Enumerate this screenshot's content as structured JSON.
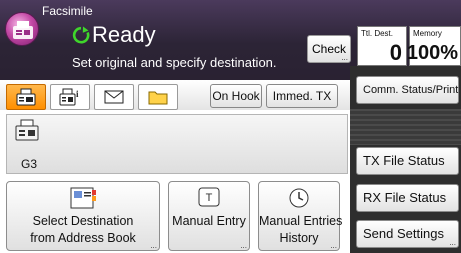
{
  "header": {
    "title": "Facsimile",
    "status": "Ready",
    "instruction": "Set original and specify destination.",
    "check_label": "Check",
    "dots": "..."
  },
  "counters": {
    "total_destinations_label": "Ttl. Dest.",
    "total_destinations_value": "0",
    "memory_label": "Memory",
    "memory_value": "100%"
  },
  "tabs": {
    "icons": [
      "fax-machine-icon",
      "fax-info-icon",
      "envelope-icon",
      "folder-icon"
    ],
    "active_index": 0,
    "on_hook_label": "On Hook",
    "immed_tx_label": "Immed. TX"
  },
  "right_panel": {
    "comm_status_label": "Comm. Status/Print",
    "tx_file_status_label": "TX File Status",
    "rx_file_status_label": "RX File Status",
    "send_settings_label": "Send Settings"
  },
  "destination": {
    "line": "G3"
  },
  "buttons": {
    "select_destination": {
      "line1": "Select Destination",
      "line2": "from Address Book"
    },
    "manual_entry": {
      "line1": "Manual Entry"
    },
    "manual_entries_history": {
      "line1": "Manual Entries",
      "line2": "History"
    }
  },
  "colors": {
    "header_bg": "#2c2436",
    "active_tab": "#ff9a1a",
    "right_panel_bg": "#2e2e2e"
  }
}
